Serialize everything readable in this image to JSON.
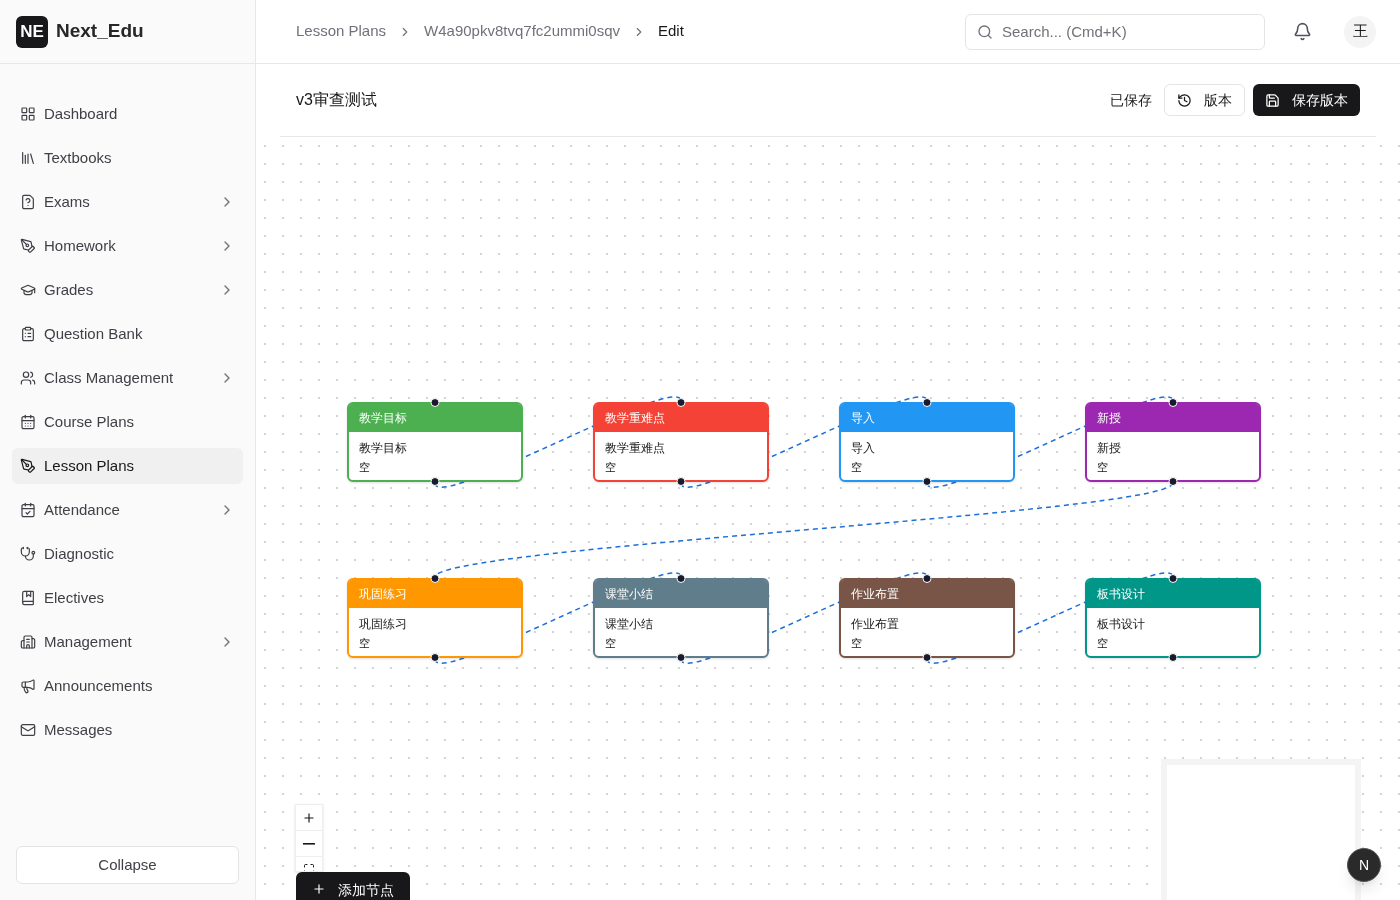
{
  "brand": {
    "logo": "NE",
    "name": "Next_Edu"
  },
  "sidebar": {
    "items": [
      {
        "label": "Dashboard",
        "has_submenu": false,
        "selected": false
      },
      {
        "label": "Textbooks",
        "has_submenu": false,
        "selected": false
      },
      {
        "label": "Exams",
        "has_submenu": true,
        "selected": false
      },
      {
        "label": "Homework",
        "has_submenu": true,
        "selected": false
      },
      {
        "label": "Grades",
        "has_submenu": true,
        "selected": false
      },
      {
        "label": "Question Bank",
        "has_submenu": false,
        "selected": false
      },
      {
        "label": "Class Management",
        "has_submenu": true,
        "selected": false
      },
      {
        "label": "Course Plans",
        "has_submenu": false,
        "selected": false
      },
      {
        "label": "Lesson Plans",
        "has_submenu": false,
        "selected": true
      },
      {
        "label": "Attendance",
        "has_submenu": true,
        "selected": false
      },
      {
        "label": "Diagnostic",
        "has_submenu": false,
        "selected": false
      },
      {
        "label": "Electives",
        "has_submenu": false,
        "selected": false
      },
      {
        "label": "Management",
        "has_submenu": true,
        "selected": false
      },
      {
        "label": "Announcements",
        "has_submenu": false,
        "selected": false
      },
      {
        "label": "Messages",
        "has_submenu": false,
        "selected": false
      }
    ],
    "collapse_button": "Collapse"
  },
  "breadcrumb": [
    "Lesson Plans",
    "W4a90pkv8tvq7fc2ummi0sqv",
    "Edit"
  ],
  "search": {
    "placeholder": "Search... (Cmd+K)"
  },
  "user_avatar": "王",
  "editor": {
    "title": "v3审查测试",
    "save_status": "已保存",
    "versions_button": "版本",
    "save_version_button": "保存版本"
  },
  "nodes": [
    {
      "header": "教学目标",
      "title": "教学目标",
      "content": "空",
      "color": "#4caf50"
    },
    {
      "header": "教学重难点",
      "title": "教学重难点",
      "content": "空",
      "color": "#f44336"
    },
    {
      "header": "导入",
      "title": "导入",
      "content": "空",
      "color": "#2196f3"
    },
    {
      "header": "新授",
      "title": "新授",
      "content": "空",
      "color": "#9c27b0"
    },
    {
      "header": "巩固练习",
      "title": "巩固练习",
      "content": "空",
      "color": "#ff9800"
    },
    {
      "header": "课堂小结",
      "title": "课堂小结",
      "content": "空",
      "color": "#607d8b"
    },
    {
      "header": "作业布置",
      "title": "作业布置",
      "content": "空",
      "color": "#795548"
    },
    {
      "header": "板书设计",
      "title": "板书设计",
      "content": "空",
      "color": "#009688"
    }
  ],
  "add_node_button": "添加节点",
  "dev_indicator": "N"
}
